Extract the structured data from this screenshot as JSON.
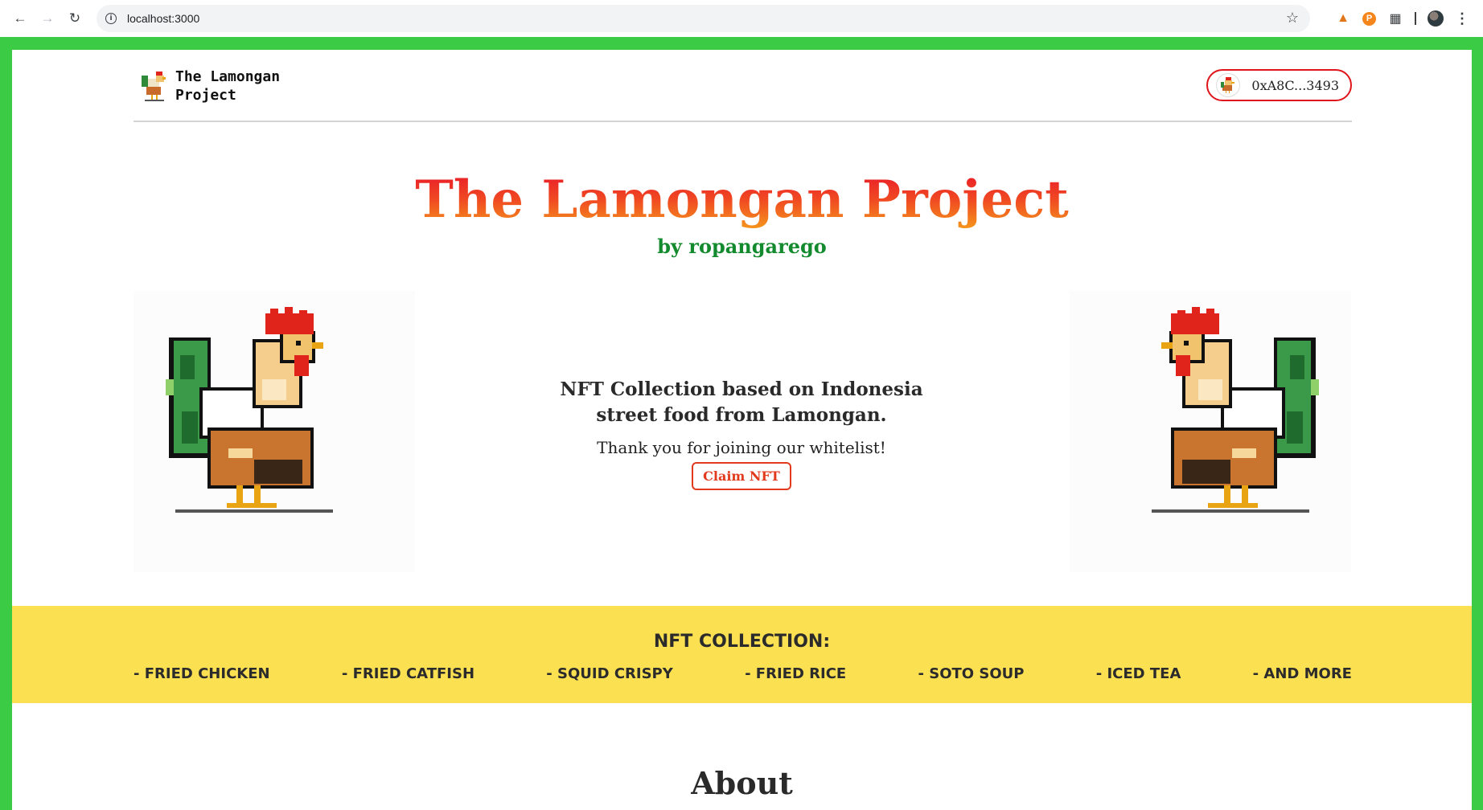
{
  "browser": {
    "url": "localhost:3000",
    "icons": [
      "back-icon",
      "forward-icon",
      "reload-icon",
      "site-info-icon",
      "bookmark-star-icon",
      "metamask-fox-icon",
      "coin-extension-icon",
      "extensions-puzzle-icon",
      "profile-avatar",
      "more-menu-icon"
    ]
  },
  "navbar": {
    "logo_text": "The Lamongan Project",
    "wallet_address": "0xA8C...3493"
  },
  "hero": {
    "title": "The Lamongan Project",
    "subtitle": "by ropangarego",
    "description": "NFT Collection based on Indonesia street food from Lamongan.",
    "thanks": "Thank you for joining our whitelist!",
    "claim_label": "Claim NFT"
  },
  "collection": {
    "title": "NFT COLLECTION:",
    "items": [
      "- FRIED CHICKEN",
      "- FRIED CATFISH",
      "- SQUID CRISPY",
      "- FRIED RICE",
      "- SOTO SOUP",
      "- ICED TEA",
      "- AND MORE"
    ]
  },
  "about": {
    "heading": "About"
  },
  "colors": {
    "frame": "#3ccb44",
    "title_gradient_start": "#e8162a",
    "title_gradient_end": "#f59b1c",
    "subtitle": "#138a2e",
    "accent_red": "#e23a1c",
    "band": "#fbe052"
  }
}
